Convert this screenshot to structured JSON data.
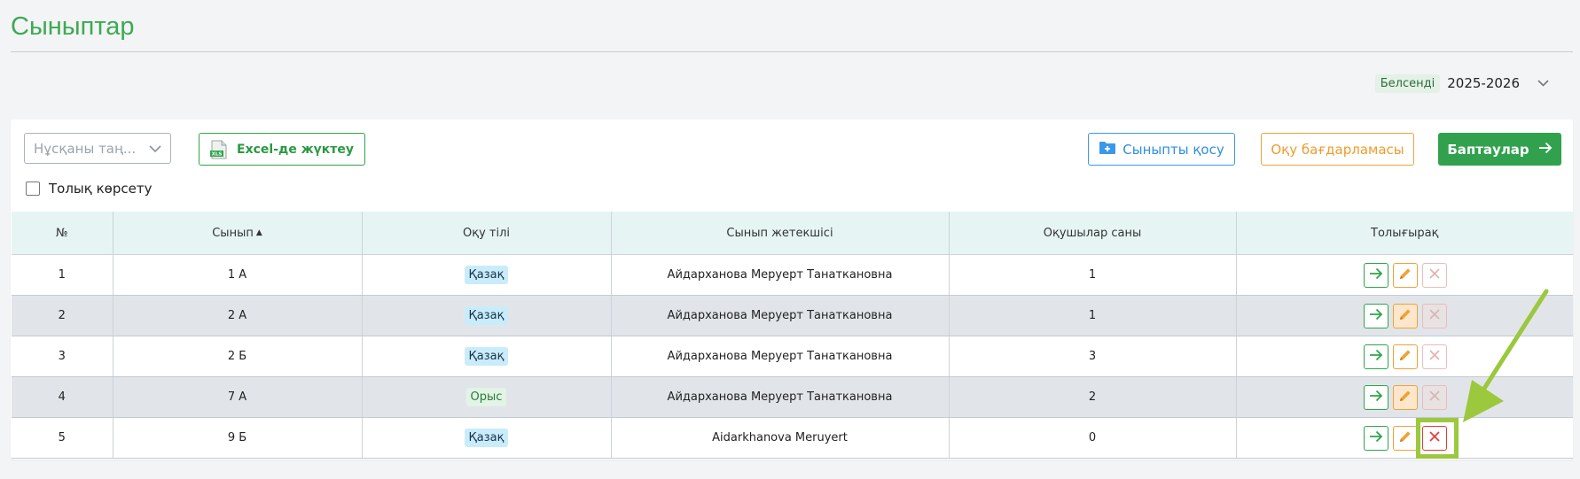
{
  "page": {
    "title": "Сыныптар"
  },
  "year": {
    "status": "Белсенді",
    "value": "2025-2026"
  },
  "toolbar": {
    "select_placeholder": "Нұсқаны таң...",
    "excel_label": "Excel-де жүктеу",
    "add_class_label": "Сыныпты қосу",
    "program_label": "Оқу бағдарламасы",
    "settings_label": "Баптаулар",
    "show_full_label": "Толық көрсету"
  },
  "table": {
    "headers": {
      "num": "№",
      "class": "Сынып",
      "language": "Оқу тілі",
      "teacher": "Сынып жетекшісі",
      "students": "Оқушылар саны",
      "details": "Толығырақ"
    },
    "rows": [
      {
        "num": "1",
        "class": "1 А",
        "language": "Қазақ",
        "teacher": "Айдарханова Меруерт Танаткановна",
        "students": "1"
      },
      {
        "num": "2",
        "class": "2 А",
        "language": "Қазақ",
        "teacher": "Айдарханова Меруерт Танаткановна",
        "students": "1"
      },
      {
        "num": "3",
        "class": "2 Б",
        "language": "Қазақ",
        "teacher": "Айдарханова Меруерт Танаткановна",
        "students": "3"
      },
      {
        "num": "4",
        "class": "7 А",
        "language": "Орыс",
        "teacher": "Айдарханова Меруерт Танаткановна",
        "students": "2"
      },
      {
        "num": "5",
        "class": "9 Б",
        "language": "Қазақ",
        "teacher": "Aidarkhanova Meruyert",
        "students": "0"
      }
    ]
  },
  "colors": {
    "brand_green": "#3daa52",
    "blue": "#2e8ee2",
    "orange": "#ee9c2c",
    "delete_red": "#e53935",
    "annotation": "#9bc83c"
  },
  "icons": {
    "excel": "xls-file-icon",
    "add_class": "folder-plus-icon",
    "settings_arrow": "arrow-right-icon",
    "go": "arrow-right-icon",
    "edit": "pencil-icon",
    "delete": "close-icon",
    "select": "chevron-down-icon",
    "year": "chevron-down-icon"
  }
}
